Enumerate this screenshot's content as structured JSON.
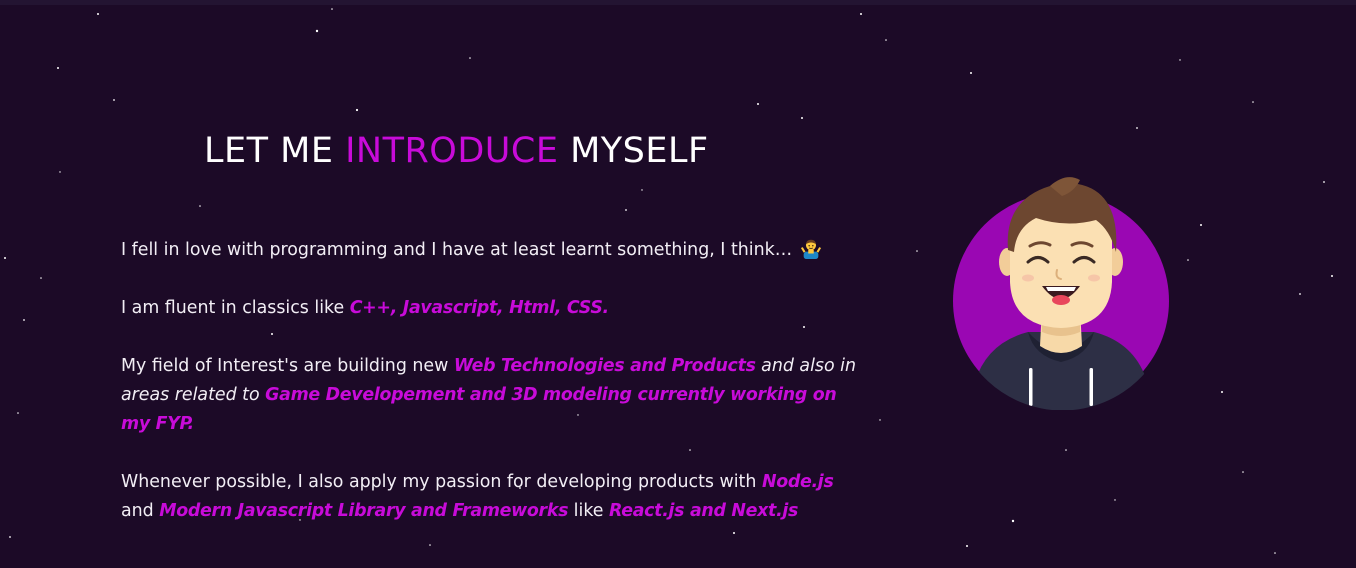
{
  "heading": {
    "part1": "LET ME",
    "accent": "INTRODUCE",
    "part2": "MYSELF"
  },
  "about": {
    "p1": {
      "text": "I fell in love with programming and I have at least learnt something, I think… ",
      "emoji_icon": "person-shrugging-icon"
    },
    "p2": {
      "text": "I am fluent in classics like ",
      "highlight": "C++, Javascript, Html, CSS."
    },
    "p3": {
      "text": "My field of Interest's are building new ",
      "highlight1": "Web Technologies and Products",
      "text2": " and also in areas related to ",
      "highlight2": "Game Developement and 3D modeling currently working on my FYP."
    },
    "p4": {
      "text": "Whenever possible, I also apply my passion for developing products with ",
      "highlight1": "Node.js",
      "text2": " and ",
      "highlight2": "Modern Javascript Library and Frameworks",
      "text3": " like ",
      "highlight3": "React.js and Next.js"
    }
  },
  "avatar": {
    "icon": "developer-avatar-icon"
  },
  "colors": {
    "background": "#1c0a27",
    "accent": "#c80bd9",
    "text": "#ffffff"
  }
}
